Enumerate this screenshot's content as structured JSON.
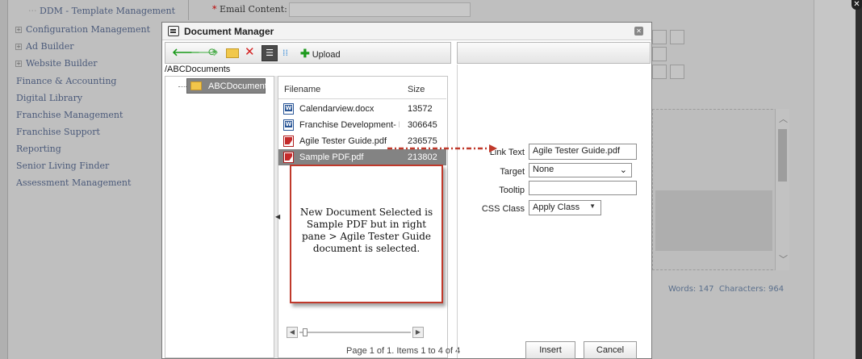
{
  "background": {
    "nav_items": [
      {
        "label": "DDM - Template Management",
        "plus": false
      },
      {
        "label": "Configuration Management",
        "plus": true
      },
      {
        "label": "Ad Builder",
        "plus": true
      },
      {
        "label": "Website Builder",
        "plus": true
      },
      {
        "label": "Finance & Accounting",
        "plus": false
      },
      {
        "label": "Digital Library",
        "plus": false
      },
      {
        "label": "Franchise Management",
        "plus": false
      },
      {
        "label": "Franchise Support",
        "plus": false
      },
      {
        "label": "Reporting",
        "plus": false
      },
      {
        "label": "Senior Living Finder",
        "plus": false
      },
      {
        "label": "Assessment Management",
        "plus": false
      }
    ],
    "email_required_mark": "*",
    "email_label": "Email Content:",
    "status": "Words: 147  Characters: 964"
  },
  "dialog": {
    "title": "Document Manager",
    "toolbar": {
      "upload_label": "Upload"
    },
    "path": "/ABCDocuments",
    "tree_folder": "ABCDocuments",
    "columns": {
      "name": "Filename",
      "size": "Size"
    },
    "files": [
      {
        "name": "Calendarview.docx",
        "size": "13572",
        "type": "docx",
        "selected": false
      },
      {
        "name": "Franchise Development- Lea",
        "size": "306645",
        "type": "docx",
        "selected": false
      },
      {
        "name": "Agile Tester Guide.pdf",
        "size": "236575",
        "type": "pdf",
        "selected": false
      },
      {
        "name": "Sample PDF.pdf",
        "size": "213802",
        "type": "pdf",
        "selected": true
      }
    ],
    "pager": "Page 1 of 1. Items 1 to 4 of 4",
    "properties": {
      "link_text_label": "Link Text",
      "link_text_value": "Agile Tester Guide.pdf",
      "target_label": "Target",
      "target_value": "None",
      "tooltip_label": "Tooltip",
      "tooltip_value": "",
      "css_class_label": "CSS Class",
      "css_class_value": "Apply Class"
    },
    "buttons": {
      "insert": "Insert",
      "cancel": "Cancel"
    }
  },
  "annotation": {
    "text": "New Document Selected is Sample PDF but in right pane > Agile Tester Guide document is selected.",
    "color": "#c0392b"
  }
}
